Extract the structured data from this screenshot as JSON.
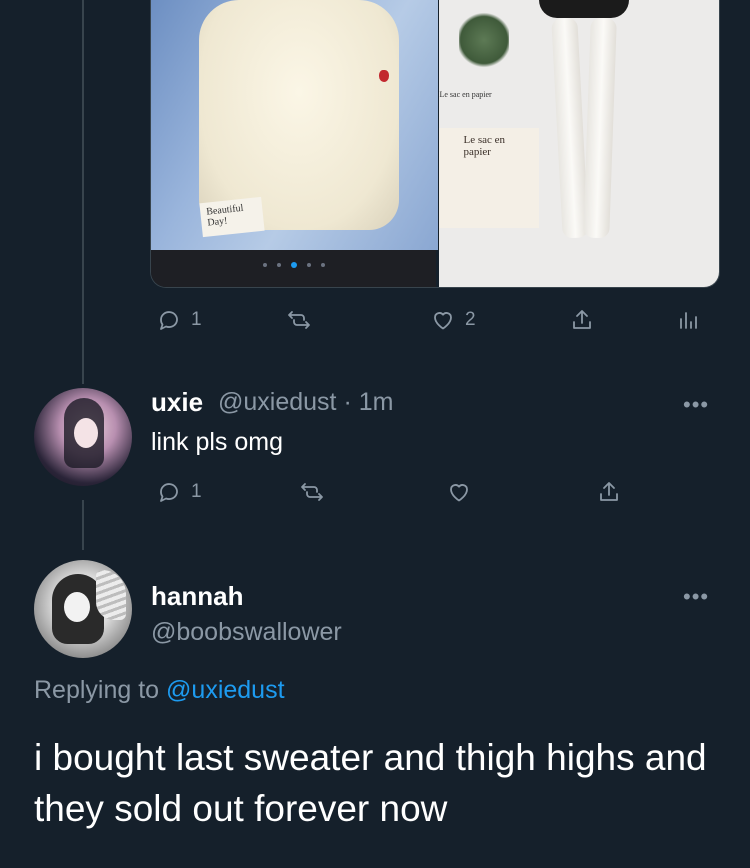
{
  "first_tweet": {
    "media": {
      "left_tag": "Beautiful Day!",
      "right_bag_small": "Le sac en papier",
      "right_bag_big": "Le sac en papier",
      "carousel_dots": 5,
      "carousel_active": 3
    },
    "actions": {
      "reply_count": "1",
      "like_count": "2"
    }
  },
  "reply_tweet": {
    "name": "uxie",
    "handle": "@uxiedust",
    "separator": "·",
    "time": "1m",
    "text": "link pls omg",
    "more": "•••",
    "actions": {
      "reply_count": "1"
    }
  },
  "main_tweet": {
    "name": "hannah",
    "handle": "@boobswallower",
    "more": "•••",
    "replying_prefix": "Replying to",
    "replying_to": "@uxiedust",
    "text": "i bought last sweater and thigh highs and they sold out forever now"
  },
  "icons": [
    "reply-icon",
    "retweet-icon",
    "like-icon",
    "share-icon",
    "analytics-icon",
    "more-icon"
  ],
  "colors": {
    "background": "#15202b",
    "secondary_text": "#8b98a5",
    "link": "#1d9bf0",
    "divider": "#38444d"
  }
}
